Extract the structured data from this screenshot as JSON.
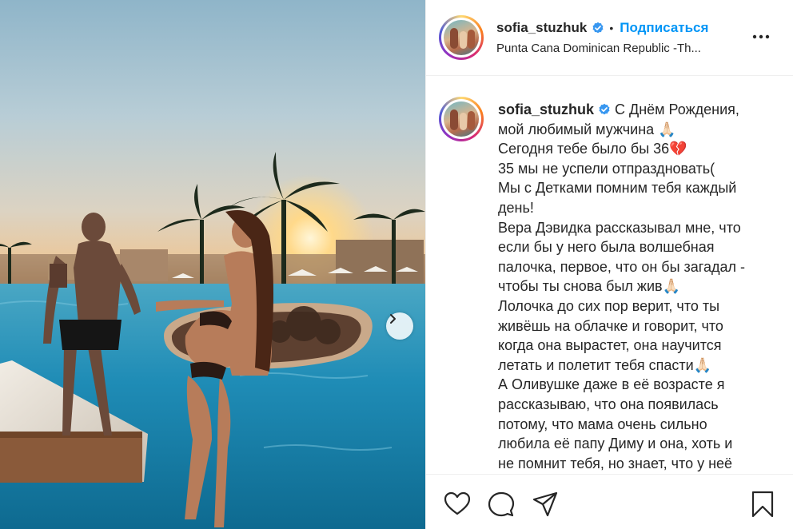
{
  "post": {
    "username": "sofia_stuzhuk",
    "verified": true,
    "follow_label": "Подписаться",
    "separator": "•",
    "location": "Punta Cana Dominican Republic -Th..."
  },
  "caption": {
    "username": "sofia_stuzhuk",
    "first_line_text": " С Днём Рождения,",
    "lines": [
      "мой любимый мужчина 🙏🏻",
      "Сегодня тебе было бы 36💔",
      "35 мы не успели отпраздновать(",
      "Мы с Детками помним тебя каждый",
      "день!",
      "Вера Дэвидка рассказывал мне, что",
      "если бы у него была волшебная",
      "палочка, первое, что он бы загадал -",
      "чтобы ты снова был жив🙏🏻",
      "Лолочка до сих пор верит, что ты",
      "живёшь на облачке и говорит, что",
      "когда она вырастет, она научится",
      "летать и полетит тебя спасти🙏🏻",
      "А Оливушке даже в её возрасте я",
      "рассказываю, что она появилась",
      "потому, что мама очень сильно",
      "любила её папу Диму и она, хоть и",
      "не помнит тебя, но знает, что у неё"
    ]
  },
  "icons": {
    "verified": "verified-badge-icon",
    "more": "more-options-icon",
    "like": "heart-icon",
    "comment": "comment-icon",
    "share": "paper-plane-icon",
    "save": "bookmark-icon",
    "next": "chevron-right-icon"
  },
  "colors": {
    "accent": "#0095f6",
    "text": "#262626",
    "border": "#efefef"
  }
}
